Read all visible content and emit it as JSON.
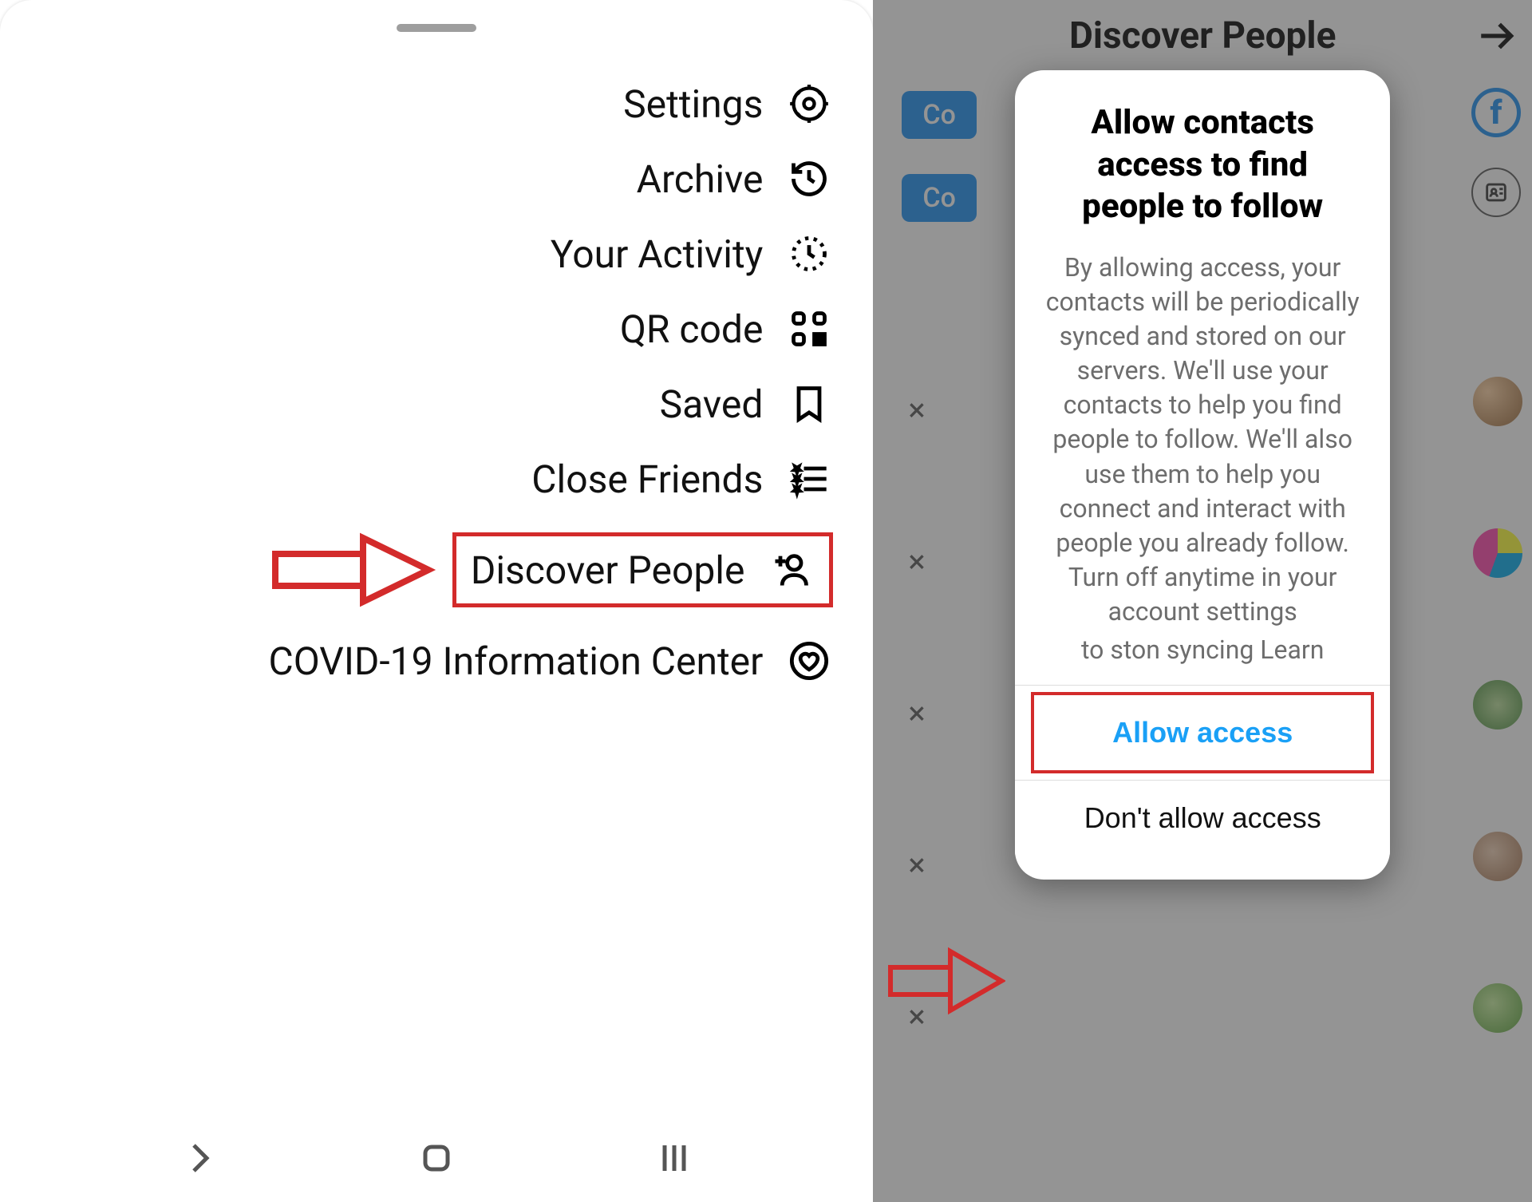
{
  "left": {
    "menu": [
      {
        "label": "Settings",
        "icon": "gear-icon"
      },
      {
        "label": "Archive",
        "icon": "history-icon"
      },
      {
        "label": "Your Activity",
        "icon": "activity-icon"
      },
      {
        "label": "QR code",
        "icon": "qr-icon"
      },
      {
        "label": "Saved",
        "icon": "bookmark-icon"
      },
      {
        "label": "Close Friends",
        "icon": "star-list-icon"
      },
      {
        "label": "Discover People",
        "icon": "add-person-icon",
        "highlighted": true
      },
      {
        "label": "COVID-19 Information Center",
        "icon": "heart-circle-icon"
      }
    ]
  },
  "right": {
    "header_title": "Discover People",
    "connect_label": "Co",
    "dialog": {
      "title": "Allow contacts access to find people to follow",
      "body": "By allowing access, your contacts will be periodically synced and stored on our servers. We'll use your contacts to help you find people to follow. We'll also use them to help you connect and interact with people you already follow. Turn off anytime in your account settings",
      "body_truncated": "to ston syncing  Learn",
      "allow_label": "Allow access",
      "deny_label": "Don't allow access"
    }
  },
  "annotation": {
    "arrow_color": "#d32b2b"
  }
}
